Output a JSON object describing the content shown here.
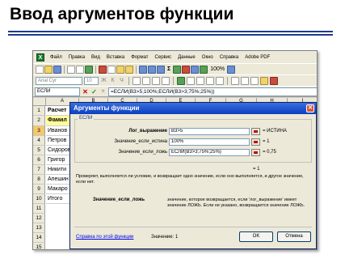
{
  "slide": {
    "title": "Ввод аргументов функции"
  },
  "menubar": {
    "items": [
      "Файл",
      "Правка",
      "Вид",
      "Вставка",
      "Формат",
      "Сервис",
      "Данные",
      "Окно",
      "Справка",
      "Adobe PDF"
    ]
  },
  "toolbar": {
    "zoom": "100%",
    "sigma": "Σ"
  },
  "format_bar": {
    "font": "Arial Cyr",
    "size": "10",
    "bold": "Ж",
    "italic": "К",
    "underline": "Ч"
  },
  "formula_bar": {
    "name_box": "ЕСЛИ",
    "cancel": "✕",
    "enter": "✓",
    "fx": "=",
    "formula": "=ЕСЛИ(B3>5;100%;ЕСЛИ(B3>3;75%;25%))"
  },
  "sheet": {
    "columns": [
      "A",
      "B",
      "C",
      "D",
      "E",
      "F",
      "G",
      "H",
      "I"
    ],
    "rows": [
      "1",
      "2",
      "3",
      "4",
      "5",
      "6",
      "7",
      "8",
      "9",
      "10",
      "11",
      "12",
      "13",
      "14",
      "15",
      "16"
    ],
    "cells": [
      "Расчет",
      "Фамил",
      "Иванов",
      "Петров",
      "Сидоров",
      "Григор",
      "Никити",
      "Апешин",
      "Макаро",
      "Итого"
    ]
  },
  "dialog": {
    "title": "Аргументы функции",
    "close": "✕",
    "function_name": "ЕСЛИ",
    "args": [
      {
        "label": "Лог_выражение",
        "value": "B3>5",
        "result": "= ИСТИНА"
      },
      {
        "label": "Значение_если_истина",
        "value": "100%",
        "result": "= 1"
      },
      {
        "label": "Значение_если_ложь",
        "value": "ЕСЛИ(B3>3;75%;25%)",
        "result": "= 0,75"
      }
    ],
    "total": "= 1",
    "description": "Проверяет, выполняется ли условие, и возвращает одно значение, если оно выполняется, и другое значение, если нет.",
    "arg_name": "Значение_если_ложь",
    "arg_description": "значение, которое возвращается, если 'лог_выражение' имеет значение ЛОЖЬ. Если не указано, возвращается значение ЛОЖЬ.",
    "help_link": "Справка по этой функции",
    "value_label": "Значение:",
    "value": "1",
    "ok": "OK",
    "cancel": "Отмена"
  }
}
